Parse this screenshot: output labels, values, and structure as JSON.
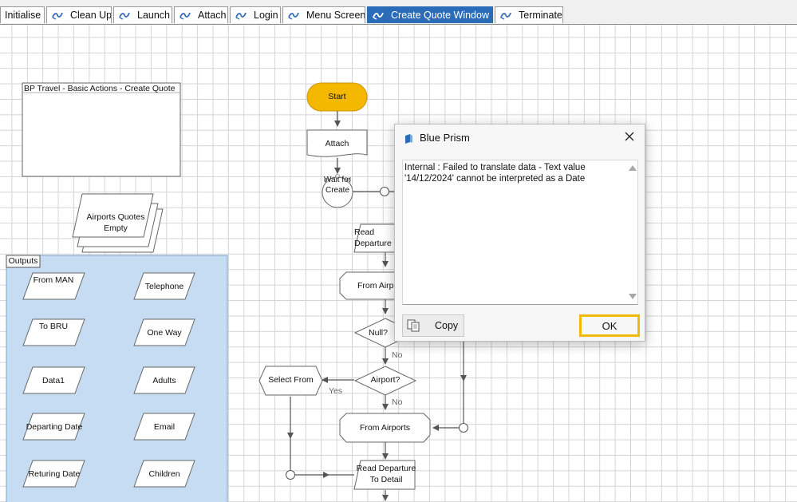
{
  "tabs": [
    {
      "label": "Initialise",
      "has_icon": false,
      "active": false
    },
    {
      "label": "Clean Up",
      "has_icon": true,
      "active": false
    },
    {
      "label": "Launch",
      "has_icon": true,
      "active": false
    },
    {
      "label": "Attach",
      "has_icon": true,
      "active": false
    },
    {
      "label": "Login",
      "has_icon": true,
      "active": false
    },
    {
      "label": "Menu Screen",
      "has_icon": true,
      "active": false
    },
    {
      "label": "Create Quote Window",
      "has_icon": true,
      "active": true
    },
    {
      "label": "Terminate",
      "has_icon": true,
      "active": false
    }
  ],
  "colors": {
    "active_tab": "#2b6cb8",
    "start_fill": "#f5b800",
    "block_fill": "#c5dcf3",
    "ok_border": "#f0b90b"
  },
  "canvas": {
    "note_title": "BP Travel - Basic Actions - Create Quote",
    "collection_label": "Airports Quotes Empty",
    "outputs_label": "Outputs",
    "outputs_left": [
      "From MAN",
      "To BRU",
      "Data1",
      "Departing Date",
      "Returing Date"
    ],
    "outputs_right": [
      "Telephone",
      "One Way",
      "Adults",
      "Email",
      "Children"
    ],
    "flow": {
      "start": "Start",
      "attach": "Attach",
      "wait": "Wait for Create",
      "read_departure_top": "Read Departure From Detail",
      "from_airports_top": "From Airports",
      "null_decision": "Null?",
      "no_1": "No",
      "airport_decision": "Airport?",
      "yes": "Yes",
      "no_2": "No",
      "select_from": "Select From",
      "from_airports": "From Airports",
      "read_departure_bottom": "Read Departure To Detail"
    }
  },
  "dialog": {
    "title": "Blue Prism",
    "message": "Internal : Failed to translate data - Text value\n'14/12/2024' cannot be interpreted as a Date",
    "copy_label": "Copy",
    "ok_label": "OK",
    "icon": "blue-prism-logo-icon",
    "close_icon": "close-icon"
  }
}
